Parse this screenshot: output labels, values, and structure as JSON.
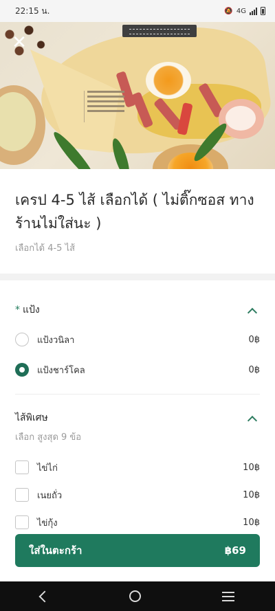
{
  "status_bar": {
    "time": "22:15 น.",
    "network": "4G"
  },
  "hero": {
    "close_icon": "close-icon"
  },
  "product": {
    "title": "เครป 4-5 ไส้ เลือกได้ ( ไม่ติ๊กซอส ทางร้านไม่ใส่นะ )",
    "subtitle": "เลือกได้ 4-5 ไส้"
  },
  "sections": [
    {
      "required_mark": "*",
      "title": "แป้ง",
      "options": [
        {
          "label": "แป้งวนิลา",
          "price": "0฿",
          "selected": false
        },
        {
          "label": "แป้งชาร์โคล",
          "price": "0฿",
          "selected": true
        }
      ]
    },
    {
      "title": "ไส้พิเศษ",
      "hint": "เลือก สูงสุด 9 ข้อ",
      "options": [
        {
          "label": "ไข่ไก่",
          "price": "10฿",
          "checked": false
        },
        {
          "label": "เนยถั่ว",
          "price": "10฿",
          "checked": false
        },
        {
          "label": "ไข่กุ้ง",
          "price": "10฿",
          "checked": false
        }
      ]
    }
  ],
  "cart": {
    "label": "ใส่ในตะกร้า",
    "price": "฿69"
  },
  "colors": {
    "accent": "#1f7a5e",
    "muted_text": "#9a9a9a"
  }
}
